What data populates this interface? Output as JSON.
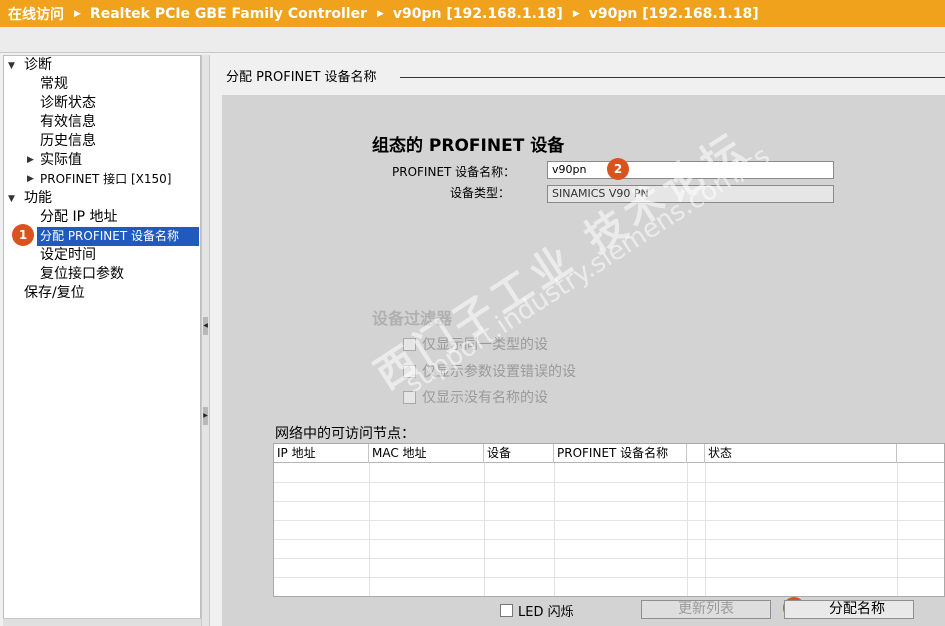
{
  "titlebar": {
    "crumbs": [
      "在线访问",
      "Realtek PCIe GBE Family Controller",
      "v90pn [192.168.1.18]",
      "v90pn [192.168.1.18]"
    ]
  },
  "tree": {
    "diagnostics": "诊断",
    "general": "常规",
    "diag_status": "诊断状态",
    "valid_info": "有效信息",
    "history": "历史信息",
    "actual_values": "实际值",
    "profinet_if": "PROFINET 接口 [X150]",
    "functions": "功能",
    "assign_ip": "分配 IP 地址",
    "assign_name": "分配 PROFINET 设备名称",
    "set_time": "设定时间",
    "reset_if": "复位接口参数",
    "save_reset": "保存/复位"
  },
  "badges": {
    "one": "1",
    "two": "2",
    "three": "3"
  },
  "main": {
    "section_title": "分配 PROFINET 设备名称",
    "config_title": "组态的 PROFINET 设备",
    "name_label": "PROFINET 设备名称：",
    "name_value": "v90pn",
    "type_label": "设备类型：",
    "type_value": "SINAMICS V90 PN",
    "filter_title": "设备过滤器",
    "filter_options": [
      "仅显示同一类型的设",
      "仅显示参数设置错误的设",
      "仅显示没有名称的设"
    ],
    "nodes_label": "网络中的可访问节点：",
    "columns": [
      "IP 地址",
      "MAC 地址",
      "设备",
      "PROFINET 设备名称",
      "状态"
    ],
    "led_label": "LED 闪烁",
    "refresh_button": "更新列表",
    "assign_button": "分配名称"
  },
  "watermark": {
    "text": "西门子工业 技术论坛",
    "url": "support.industry.siemens.com/cs"
  },
  "colors": {
    "titlebar": "#f0a21c",
    "selection": "#1f5bbf",
    "badge": "#d9531e",
    "panel": "#d3d3d3"
  }
}
